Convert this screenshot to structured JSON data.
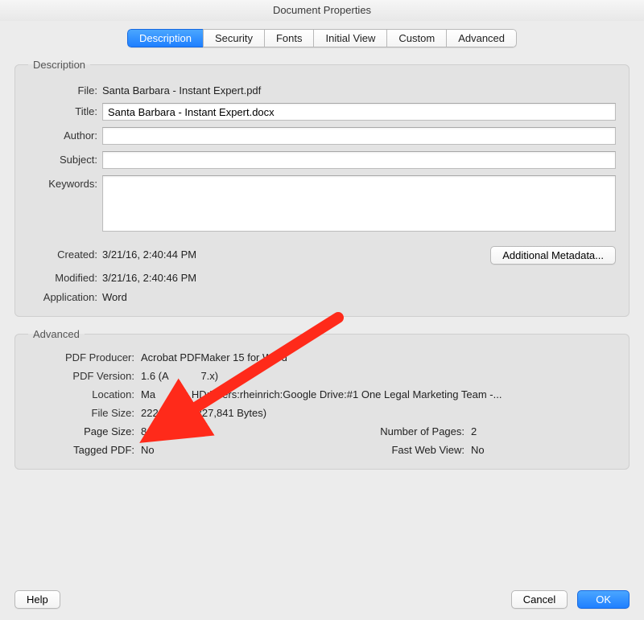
{
  "window": {
    "title": "Document Properties"
  },
  "tabs": {
    "description": "Description",
    "security": "Security",
    "fonts": "Fonts",
    "initial_view": "Initial View",
    "custom": "Custom",
    "advanced": "Advanced"
  },
  "groups": {
    "description_legend": "Description",
    "advanced_legend": "Advanced"
  },
  "description": {
    "labels": {
      "file": "File:",
      "title": "Title:",
      "author": "Author:",
      "subject": "Subject:",
      "keywords": "Keywords:",
      "created": "Created:",
      "modified": "Modified:",
      "application": "Application:"
    },
    "file": "Santa Barbara - Instant Expert.pdf",
    "title": "Santa Barbara - Instant Expert.docx",
    "author": "",
    "subject": "",
    "keywords": "",
    "created": "3/21/16, 2:40:44 PM",
    "modified": "3/21/16, 2:40:46 PM",
    "application": "Word",
    "additional_metadata_btn": "Additional Metadata..."
  },
  "advanced": {
    "labels": {
      "pdf_producer": "PDF Producer:",
      "pdf_version": "PDF Version:",
      "location": "Location:",
      "file_size": "File Size:",
      "page_size": "Page Size:",
      "number_pages": "Number of Pages:",
      "tagged_pdf": "Tagged PDF:",
      "fast_web_view": "Fast Web View:"
    },
    "pdf_producer": "Acrobat PDFMaker 15 for Word",
    "pdf_version_prefix": "1.6 (A",
    "pdf_version_suffix": "7.x)",
    "location_prefix": "Ma",
    "location_suffix": "h HD:Users:rheinrich:Google Drive:#1 One Legal Marketing Team -...",
    "file_size": "222.50 KB (227,841 Bytes)",
    "page_size": "8.50 x 10.99 in",
    "number_pages": "2",
    "tagged_pdf": "No",
    "fast_web_view": "No"
  },
  "buttons": {
    "help": "Help",
    "cancel": "Cancel",
    "ok": "OK"
  },
  "annotation": {
    "arrow_color": "#ff2a1a"
  }
}
